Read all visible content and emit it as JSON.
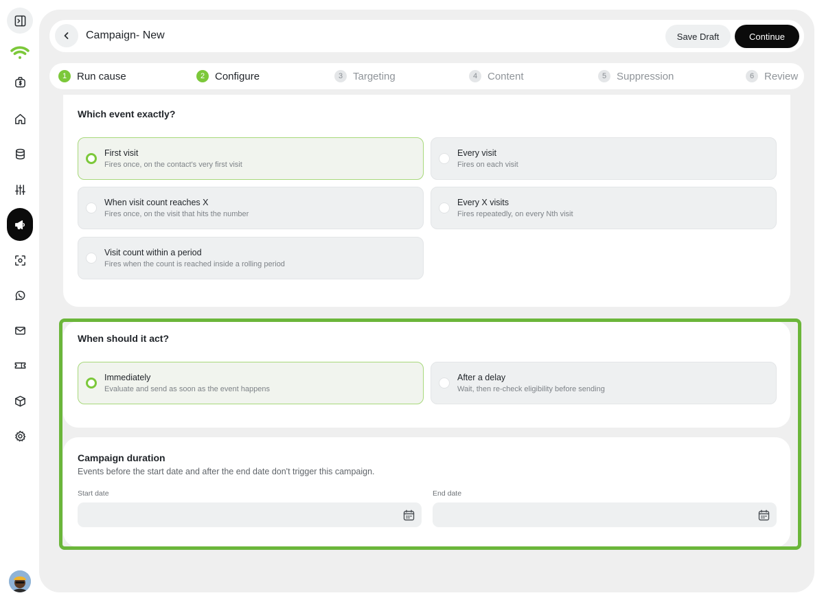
{
  "sidebar": {
    "items": [
      {
        "icon": "sidebar-toggle-icon"
      },
      {
        "icon": "wifi-logo-icon"
      },
      {
        "icon": "money-bag-icon"
      },
      {
        "icon": "home-icon"
      },
      {
        "icon": "database-icon"
      },
      {
        "icon": "sliders-icon"
      },
      {
        "icon": "megaphone-icon",
        "active": true
      },
      {
        "icon": "scan-icon"
      },
      {
        "icon": "whatsapp-icon"
      },
      {
        "icon": "mail-icon"
      },
      {
        "icon": "ticket-icon"
      },
      {
        "icon": "box-icon"
      },
      {
        "icon": "settings-icon"
      }
    ],
    "accent_color": "#7cc83a"
  },
  "header": {
    "title": "Campaign- New",
    "save_draft_label": "Save Draft",
    "continue_label": "Continue"
  },
  "steps": [
    {
      "num": "1",
      "label": "Run cause",
      "state": "done"
    },
    {
      "num": "2",
      "label": "Configure",
      "state": "done"
    },
    {
      "num": "3",
      "label": "Targeting",
      "state": "pending"
    },
    {
      "num": "4",
      "label": "Content",
      "state": "pending"
    },
    {
      "num": "5",
      "label": "Suppression",
      "state": "pending"
    },
    {
      "num": "6",
      "label": "Review",
      "state": "pending"
    }
  ],
  "event_section": {
    "title": "Which event exactly?",
    "options": [
      {
        "title": "First visit",
        "desc": "Fires once, on the contact's very first visit",
        "selected": true
      },
      {
        "title": "Every visit",
        "desc": "Fires on each visit",
        "selected": false
      },
      {
        "title": "When visit count reaches X",
        "desc": "Fires once, on the visit that hits the number",
        "selected": false
      },
      {
        "title": "Every X visits",
        "desc": "Fires repeatedly, on every Nth visit",
        "selected": false
      },
      {
        "title": "Visit count within a period",
        "desc": "Fires when the count is reached inside a rolling period",
        "selected": false
      }
    ]
  },
  "act_section": {
    "title": "When should it act?",
    "options": [
      {
        "title": "Immediately",
        "desc": "Evaluate and send as soon as the event happens",
        "selected": true
      },
      {
        "title": "After a delay",
        "desc": "Wait, then re-check eligibility before sending",
        "selected": false
      }
    ]
  },
  "duration_section": {
    "title": "Campaign duration",
    "desc": "Events before the start date and after the end date don't trigger this campaign.",
    "start_label": "Start date",
    "start_value": "",
    "end_label": "End date",
    "end_value": ""
  },
  "colors": {
    "highlight": "#6bb63a",
    "primary_button": "#0b0b0b"
  }
}
